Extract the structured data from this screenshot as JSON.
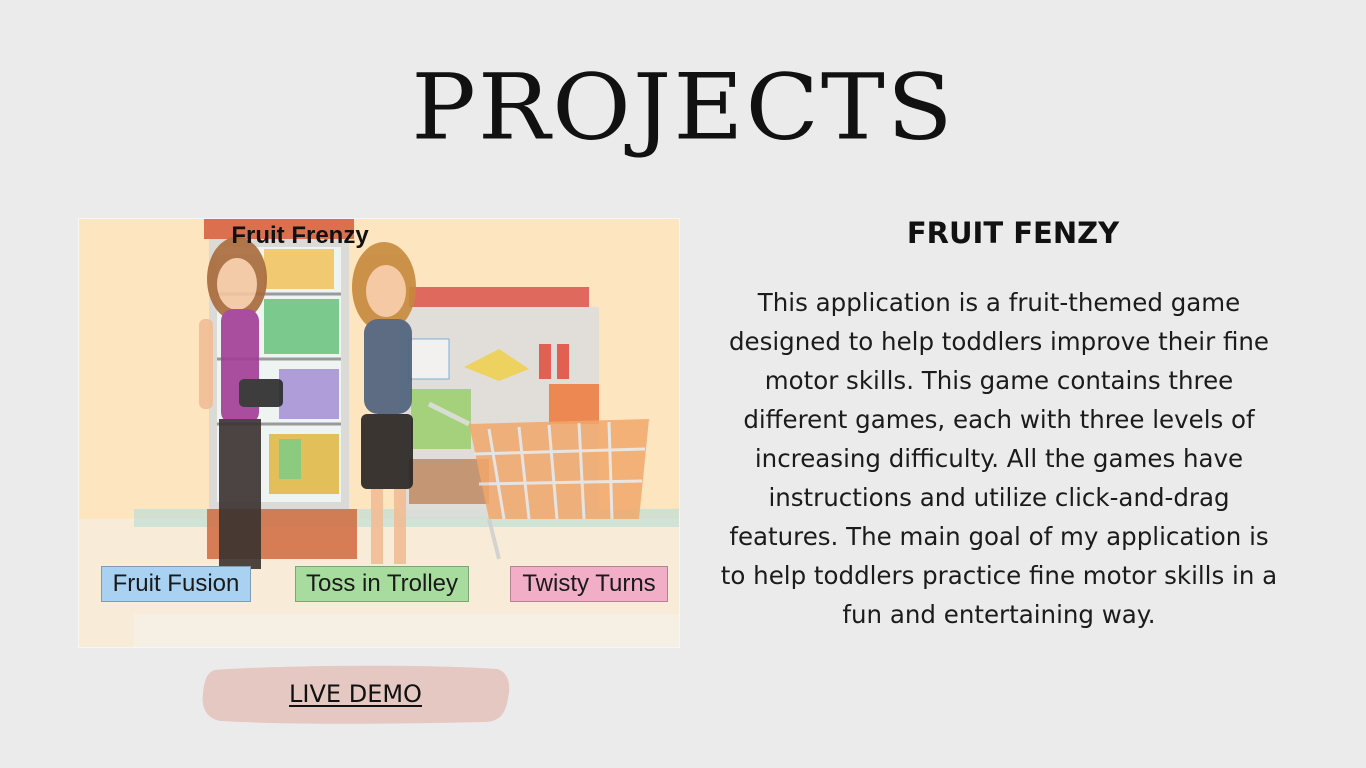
{
  "page": {
    "title": "PROJECTS",
    "background_color": "#ebebeb"
  },
  "project": {
    "heading": "FRUIT FENZY",
    "description": "This application is a fruit-themed game designed to help toddlers improve their fine motor skills. This game contains three different games, each with three levels of increasing difficulty. All the games have instructions and utilize click-and-drag features. The main goal of my application is to help toddlers practice fine motor skills in a fun and entertaining way.",
    "live_demo_label": "LIVE DEMO "
  },
  "screenshot": {
    "game_title": "Fruit Frenzy",
    "buttons": [
      {
        "label": "Fruit Fusion",
        "color": "#a9d2f2"
      },
      {
        "label": "Toss in Trolley",
        "color": "#a7dc9e"
      },
      {
        "label": "Twisty Turns",
        "color": "#f1aec6"
      }
    ]
  },
  "colors": {
    "demo_button": "#e6c8c2"
  }
}
